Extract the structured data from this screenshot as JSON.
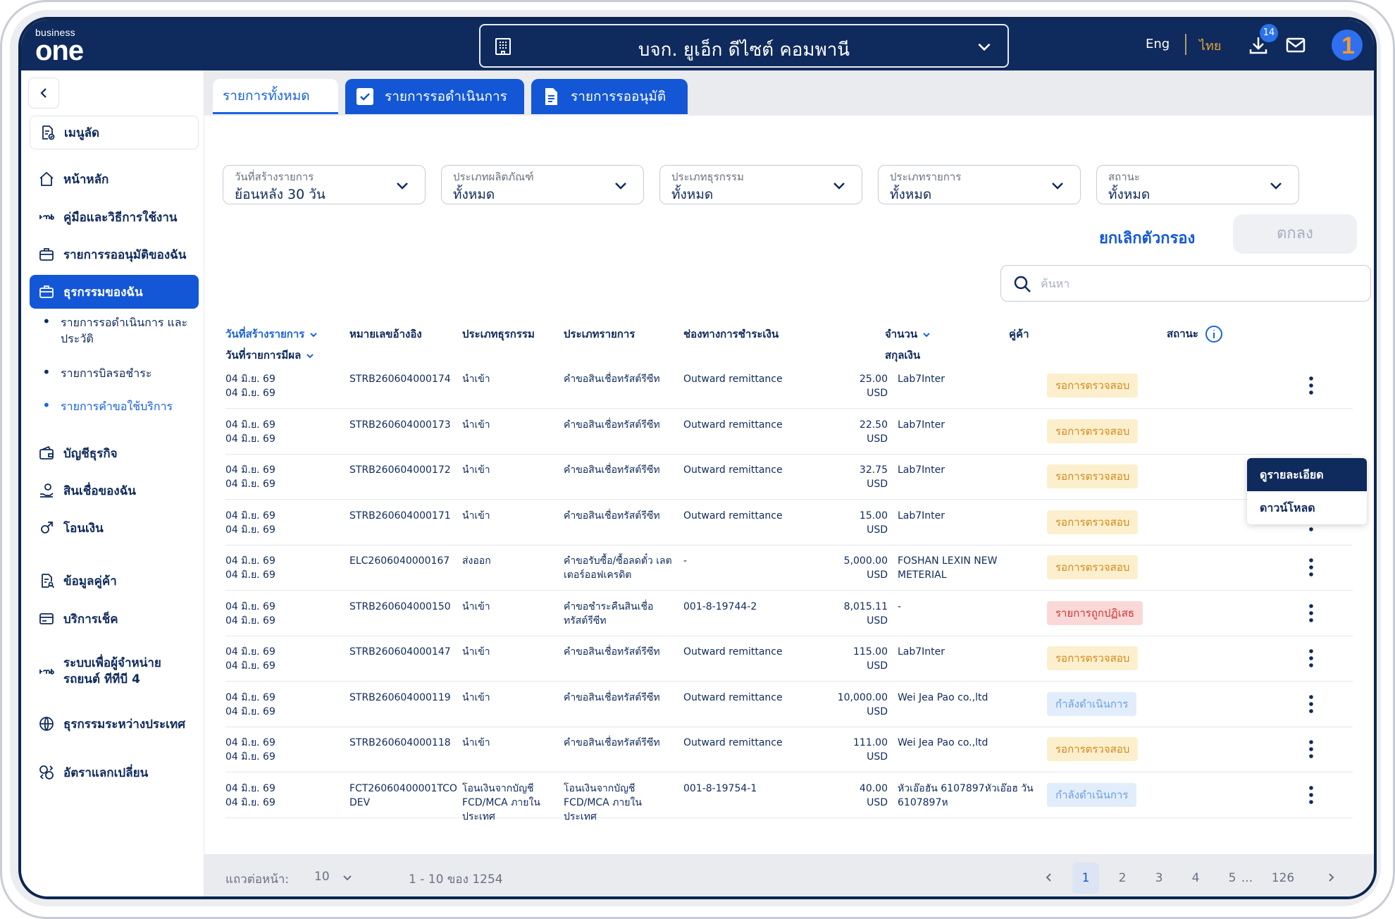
{
  "header": {
    "logo_small": "business",
    "logo_big": "one",
    "company_name": "บจก. ยูเอ็ก ดีไซต์ คอมพานี",
    "lang_en": "Eng",
    "lang_th": "ไทย",
    "download_badge": "14",
    "colors": {
      "topbar": "#0f2a5c",
      "accent": "#1357d6",
      "lang_active": "#e6a23c"
    }
  },
  "sidebar": {
    "items": [
      {
        "label": "เมนูลัด",
        "icon": "doc-check-icon"
      },
      {
        "label": "หน้าหลัก",
        "icon": "home-icon"
      },
      {
        "label": "คู่มือและวิธีการใช้งาน",
        "icon": "ttb-icon"
      },
      {
        "label": "รายการรออนุมัติของฉัน",
        "icon": "briefcase-icon"
      },
      {
        "label": "ธุรกรรมของฉัน",
        "icon": "briefcase-icon"
      },
      {
        "label": "บัญชีธุรกิจ",
        "icon": "wallet-icon"
      },
      {
        "label": "สินเชื่อของฉัน",
        "icon": "loan-icon"
      },
      {
        "label": "โอนเงิน",
        "icon": "transfer-icon"
      },
      {
        "label": "ข้อมูลคู่ค้า",
        "icon": "partner-doc-icon"
      },
      {
        "label": "บริการเช็ค",
        "icon": "cheque-icon"
      },
      {
        "label": "ระบบเพื่อผู้จำหน่ายรถยนต์ ทีทีบี 4",
        "icon": "ttb-icon"
      },
      {
        "label": "ธุรกรรมระหว่างประเทศ",
        "icon": "globe-icon"
      },
      {
        "label": "อัตราแลกเปลี่ยน",
        "icon": "exchange-icon"
      }
    ],
    "sub_items": [
      {
        "label": "รายการรอดำเนินการ และประวัติ"
      },
      {
        "label": "รายการบิลรอชำระ"
      },
      {
        "label": "รายการคำขอใช้บริการ"
      }
    ]
  },
  "tabs": [
    {
      "label": "รายการทั้งหมด"
    },
    {
      "label": "รายการรอดำเนินการ"
    },
    {
      "label": "รายการรออนุมัติ"
    }
  ],
  "filters": [
    {
      "label": "วันที่สร้างรายการ",
      "value": "ย้อนหลัง 30 วัน"
    },
    {
      "label": "ประเภทผลิตภัณฑ์",
      "value": "ทั้งหมด"
    },
    {
      "label": "ประเภทธุรกรรม",
      "value": "ทั้งหมด"
    },
    {
      "label": "ประเภทรายการ",
      "value": "ทั้งหมด"
    },
    {
      "label": "สถานะ",
      "value": "ทั้งหมด"
    }
  ],
  "actions": {
    "clear": "ยกเลิกตัวกรอง",
    "ok": "ตกลง"
  },
  "search": {
    "placeholder": "ค้นหา"
  },
  "table": {
    "headers": {
      "created": "วันที่สร้างรายการ",
      "effective": "วันที่รายการมีผล",
      "ref": "หมายเลขอ้างอิง",
      "txn_type": "ประเภทธุรกรรม",
      "item_type": "ประเภทรายการ",
      "channel": "ช่องทางการชำระเงิน",
      "amount": "จำนวน",
      "currency": "สกุลเงิน",
      "partner": "คู่ค้า",
      "status": "สถานะ"
    },
    "rows": [
      {
        "created": "04 มิ.ย. 69",
        "effective": "04 มิ.ย. 69",
        "ref": "STRB260604000174",
        "txn_type": "นำเข้า",
        "item_type": "คำขอสินเชื่อทรัสต์รีซีท",
        "channel": "Outward remittance",
        "amount": "25.00",
        "currency": "USD",
        "partner": "Lab7Inter",
        "status": "รอการตรวจสอบ",
        "status_kind": "pending"
      },
      {
        "created": "04 มิ.ย. 69",
        "effective": "04 มิ.ย. 69",
        "ref": "STRB260604000173",
        "txn_type": "นำเข้า",
        "item_type": "คำขอสินเชื่อทรัสต์รีซีท",
        "channel": "Outward remittance",
        "amount": "22.50",
        "currency": "USD",
        "partner": "Lab7Inter",
        "status": "รอการตรวจสอบ",
        "status_kind": "pending"
      },
      {
        "created": "04 มิ.ย. 69",
        "effective": "04 มิ.ย. 69",
        "ref": "STRB260604000172",
        "txn_type": "นำเข้า",
        "item_type": "คำขอสินเชื่อทรัสต์รีซีท",
        "channel": "Outward remittance",
        "amount": "32.75",
        "currency": "USD",
        "partner": "Lab7Inter",
        "status": "รอการตรวจสอบ",
        "status_kind": "pending"
      },
      {
        "created": "04 มิ.ย. 69",
        "effective": "04 มิ.ย. 69",
        "ref": "STRB260604000171",
        "txn_type": "นำเข้า",
        "item_type": "คำขอสินเชื่อทรัสต์รีซีท",
        "channel": "Outward remittance",
        "amount": "15.00",
        "currency": "USD",
        "partner": "Lab7Inter",
        "status": "รอการตรวจสอบ",
        "status_kind": "pending"
      },
      {
        "created": "04 มิ.ย. 69",
        "effective": "04 มิ.ย. 69",
        "ref": "ELC2606040000167",
        "txn_type": "ส่งออก",
        "item_type": "คำขอรับซื้อ/ซื้อลดตั๋ว เลตเตอร์ออฟเครดิต",
        "channel": "-",
        "amount": "5,000.00",
        "currency": "USD",
        "partner": "FOSHAN LEXIN NEW METERIAL",
        "status": "รอการตรวจสอบ",
        "status_kind": "pending"
      },
      {
        "created": "04 มิ.ย. 69",
        "effective": "04 มิ.ย. 69",
        "ref": "STRB260604000150",
        "txn_type": "นำเข้า",
        "item_type": "คำขอชำระคืนสินเชื่อ ทรัสต์รีซีท",
        "channel": "001-8-19744-2",
        "amount": "8,015.11",
        "currency": "USD",
        "partner": "-",
        "status": "รายการถูกปฏิเสธ",
        "status_kind": "rejected"
      },
      {
        "created": "04 มิ.ย. 69",
        "effective": "04 มิ.ย. 69",
        "ref": "STRB260604000147",
        "txn_type": "นำเข้า",
        "item_type": "คำขอสินเชื่อทรัสต์รีซีท",
        "channel": "Outward remittance",
        "amount": "115.00",
        "currency": "USD",
        "partner": "Lab7Inter",
        "status": "รอการตรวจสอบ",
        "status_kind": "pending"
      },
      {
        "created": "04 มิ.ย. 69",
        "effective": "04 มิ.ย. 69",
        "ref": "STRB260604000119",
        "txn_type": "นำเข้า",
        "item_type": "คำขอสินเชื่อทรัสต์รีซีท",
        "channel": "Outward remittance",
        "amount": "10,000.00",
        "currency": "USD",
        "partner": "Wei Jea Pao co.,ltd",
        "status": "กำลังดำเนินการ",
        "status_kind": "progress"
      },
      {
        "created": "04 มิ.ย. 69",
        "effective": "04 มิ.ย. 69",
        "ref": "STRB260604000118",
        "txn_type": "นำเข้า",
        "item_type": "คำขอสินเชื่อทรัสต์รีซีท",
        "channel": "Outward remittance",
        "amount": "111.00",
        "currency": "USD",
        "partner": "Wei Jea Pao co.,ltd",
        "status": "รอการตรวจสอบ",
        "status_kind": "pending"
      },
      {
        "created": "04 มิ.ย. 69",
        "effective": "04 มิ.ย. 69",
        "ref": "FCT26060400001TCO DEV",
        "txn_type": "โอนเงินจากบัญชี FCD/MCA ภายใน ประเทศ",
        "item_type": "โอนเงินจากบัญชี FCD/MCA ภายใน ประเทศ",
        "channel": "001-8-19754-1",
        "amount": "40.00",
        "currency": "USD",
        "partner": "หัวเอ๊อฮัน 6107897หัวเอ๊อฮ วัน 6107897ห",
        "status": "กำลังดำเนินการ",
        "status_kind": "progress"
      }
    ]
  },
  "row_menu": {
    "items": [
      "ดูรายละเอียด",
      "ดาวน์โหลด"
    ]
  },
  "pagination": {
    "rows_per_page_label": "แถวต่อหน้า:",
    "rows_per_page": "10",
    "range": "1 - 10 ของ 1254",
    "pages": [
      "1",
      "2",
      "3",
      "4",
      "5",
      "...",
      "126"
    ],
    "current": "1"
  }
}
